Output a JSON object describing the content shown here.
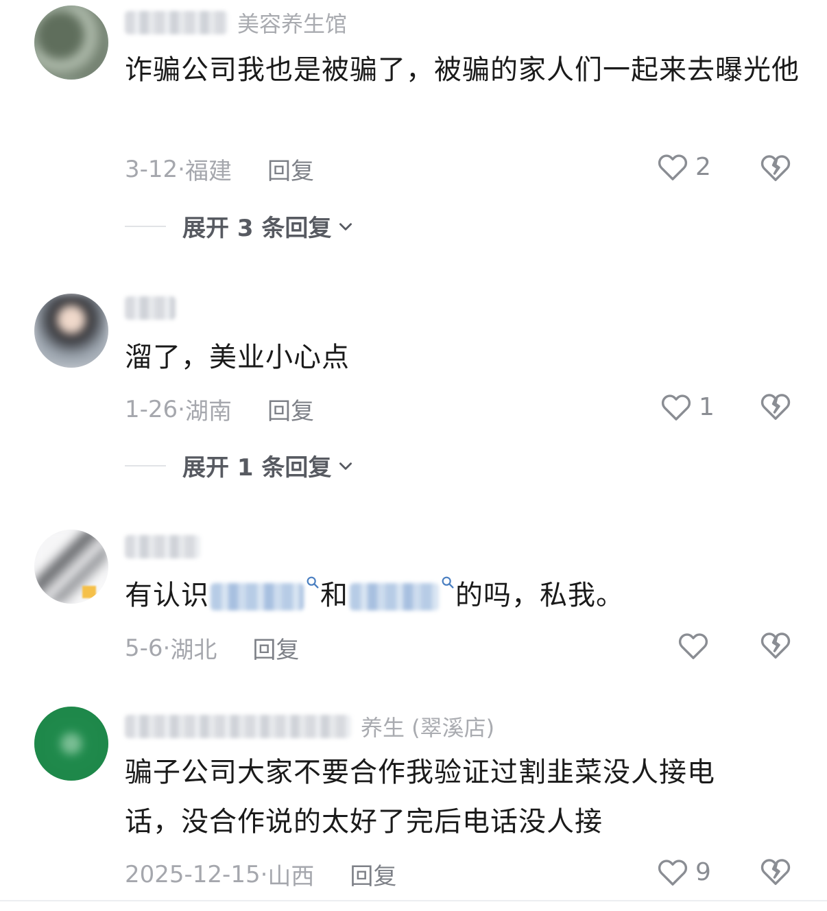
{
  "comments": [
    {
      "username_suffix": "美容养生馆",
      "text": "诈骗公司我也是被骗了，被骗的家人们一起来去曝光他",
      "date": "3-12",
      "location": "福建",
      "reply_label": "回复",
      "likes": "2",
      "expand_label": "展开 3 条回复"
    },
    {
      "username_suffix": "",
      "text": "溜了，美业小心点",
      "date": "1-26",
      "location": "湖南",
      "reply_label": "回复",
      "likes": "1",
      "expand_label": "展开 1 条回复"
    },
    {
      "username_suffix": "",
      "text_parts": [
        "有认识",
        "和",
        "的吗，私我。"
      ],
      "date": "5-6",
      "location": "湖北",
      "reply_label": "回复",
      "likes": ""
    },
    {
      "username_suffix": "养生 (翠溪店)",
      "text": "骗子公司大家不要合作我验证过割韭菜没人接电话，没合作说的太好了完后电话没人接",
      "date": "2025-12-15",
      "location": "山西",
      "reply_label": "回复",
      "likes": "9"
    }
  ],
  "meta_separator": "·",
  "icons": {
    "like": "heart-outline-icon",
    "dislike": "broken-heart-icon",
    "expand": "chevron-down-icon",
    "mention": "search-icon"
  },
  "colors": {
    "text": "#1a1a1a",
    "meta": "#a5a7ad",
    "mention": "#4a7fc1"
  }
}
